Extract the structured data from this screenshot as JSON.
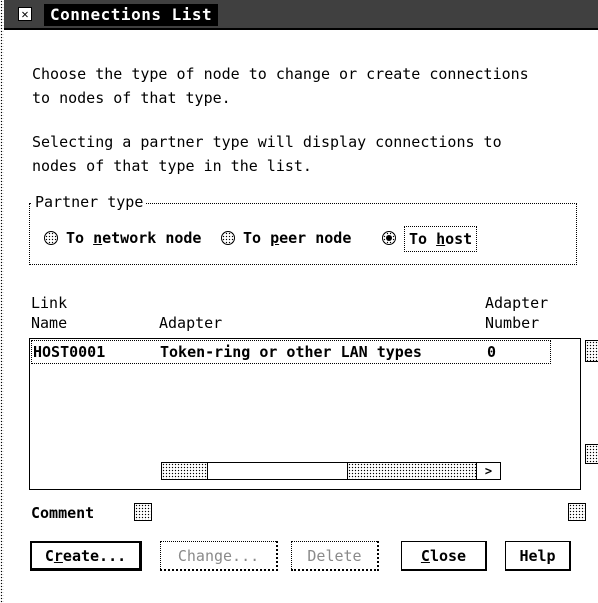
{
  "window": {
    "title": "Connections List",
    "system_menu_icon": "close-x-icon"
  },
  "instructions": [
    "Choose the type of node to change or create connections",
    "to nodes of that type.",
    "Selecting a partner type will display connections to",
    "nodes of that type in the list."
  ],
  "partner_type": {
    "label": "Partner type",
    "options": [
      {
        "pre": "To ",
        "mnemonic": "n",
        "post": "etwork node",
        "selected": false
      },
      {
        "pre": "To ",
        "mnemonic": "p",
        "post": "eer node",
        "selected": false
      },
      {
        "pre": "To ",
        "mnemonic": "h",
        "post": "ost",
        "selected": true
      }
    ]
  },
  "list": {
    "columns": [
      {
        "line1": "Link",
        "line2": "Name"
      },
      {
        "line1": "",
        "line2": "Adapter"
      },
      {
        "line1": "Adapter",
        "line2": "Number"
      }
    ],
    "rows": [
      {
        "link_name": "HOST0001",
        "adapter": "Token-ring or other LAN types",
        "adapter_number": "0"
      }
    ]
  },
  "comment": {
    "label": "Comment",
    "value": ""
  },
  "buttons": [
    {
      "pre": "C",
      "mnemonic": "r",
      "post": "eate...",
      "enabled": true,
      "default": true
    },
    {
      "pre": "Change...",
      "mnemonic": "",
      "post": "",
      "enabled": false,
      "default": false
    },
    {
      "pre": "Delete",
      "mnemonic": "",
      "post": "",
      "enabled": false,
      "default": false
    },
    {
      "pre": "",
      "mnemonic": "C",
      "post": "lose",
      "enabled": true,
      "default": false
    },
    {
      "pre": "Help",
      "mnemonic": "",
      "post": "",
      "enabled": true,
      "default": false
    }
  ]
}
